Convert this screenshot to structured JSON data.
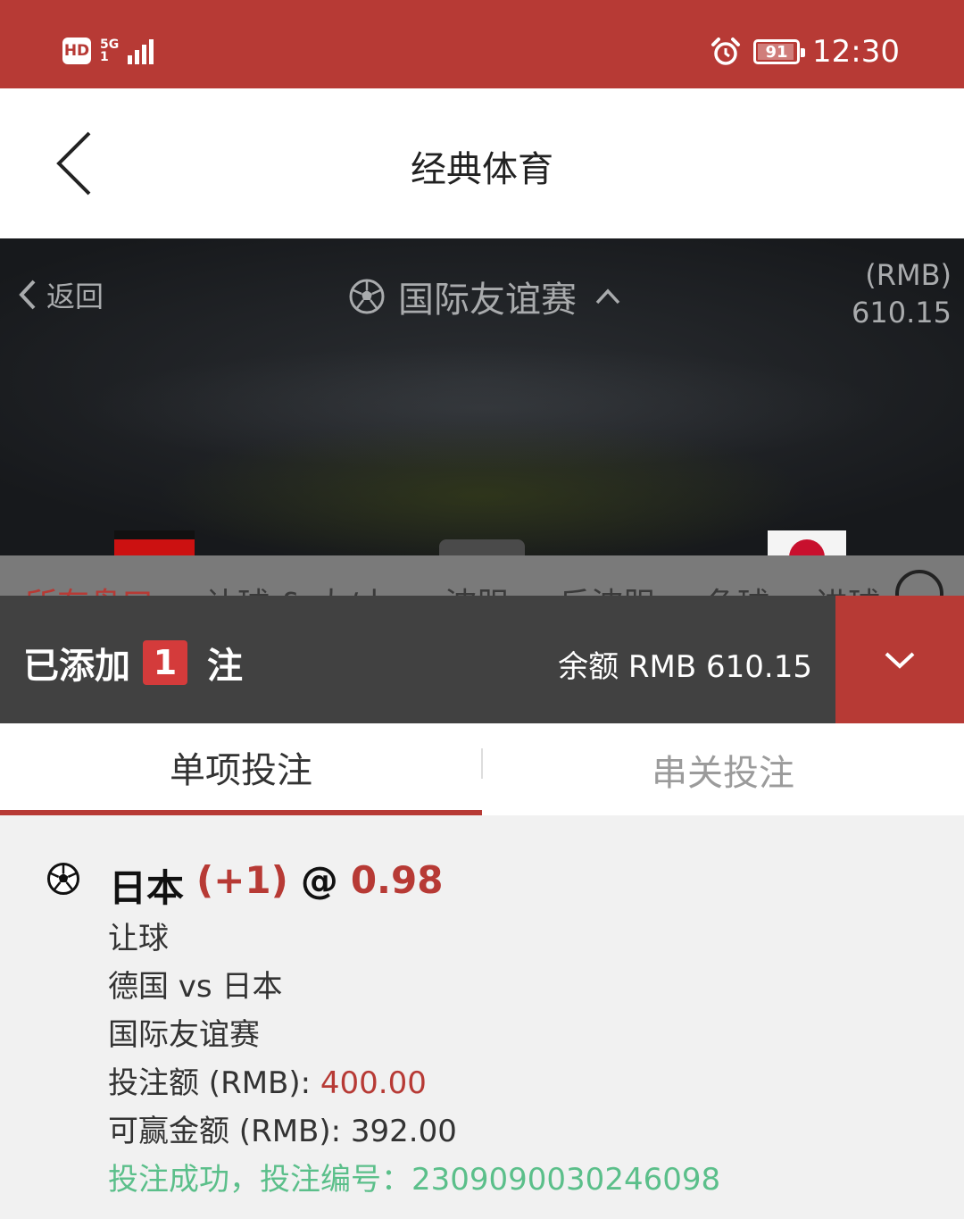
{
  "status_bar": {
    "hd": "HD",
    "network": "5G",
    "network_sub": "1",
    "battery": "91",
    "time": "12:30"
  },
  "header": {
    "title": "经典体育"
  },
  "hero": {
    "back_label": "返回",
    "league": "国际友谊赛",
    "balance_currency": "(RMB)",
    "balance_amount": "610.15"
  },
  "market_tabs": [
    "所有盘口",
    "让球 & 大/小",
    "波胆",
    "反波胆",
    "角球",
    "进球"
  ],
  "bet_slip": {
    "added_prefix": "已添加",
    "count": "1",
    "added_suffix": "注",
    "balance": "余额 RMB 610.15"
  },
  "bet_tabs": {
    "single": "单项投注",
    "parlay": "串关投注"
  },
  "ticket": {
    "selection": "日本",
    "handicap": "(+1)",
    "at": "@",
    "odds": "0.98",
    "market": "让球",
    "match": "德国 vs 日本",
    "league": "国际友谊赛",
    "stake_label": "投注额 (RMB): ",
    "stake_value": "400.00",
    "payout_label": "可赢金额 (RMB): ",
    "payout_value": "392.00",
    "success": "投注成功，投注编号：2309090030246098"
  }
}
